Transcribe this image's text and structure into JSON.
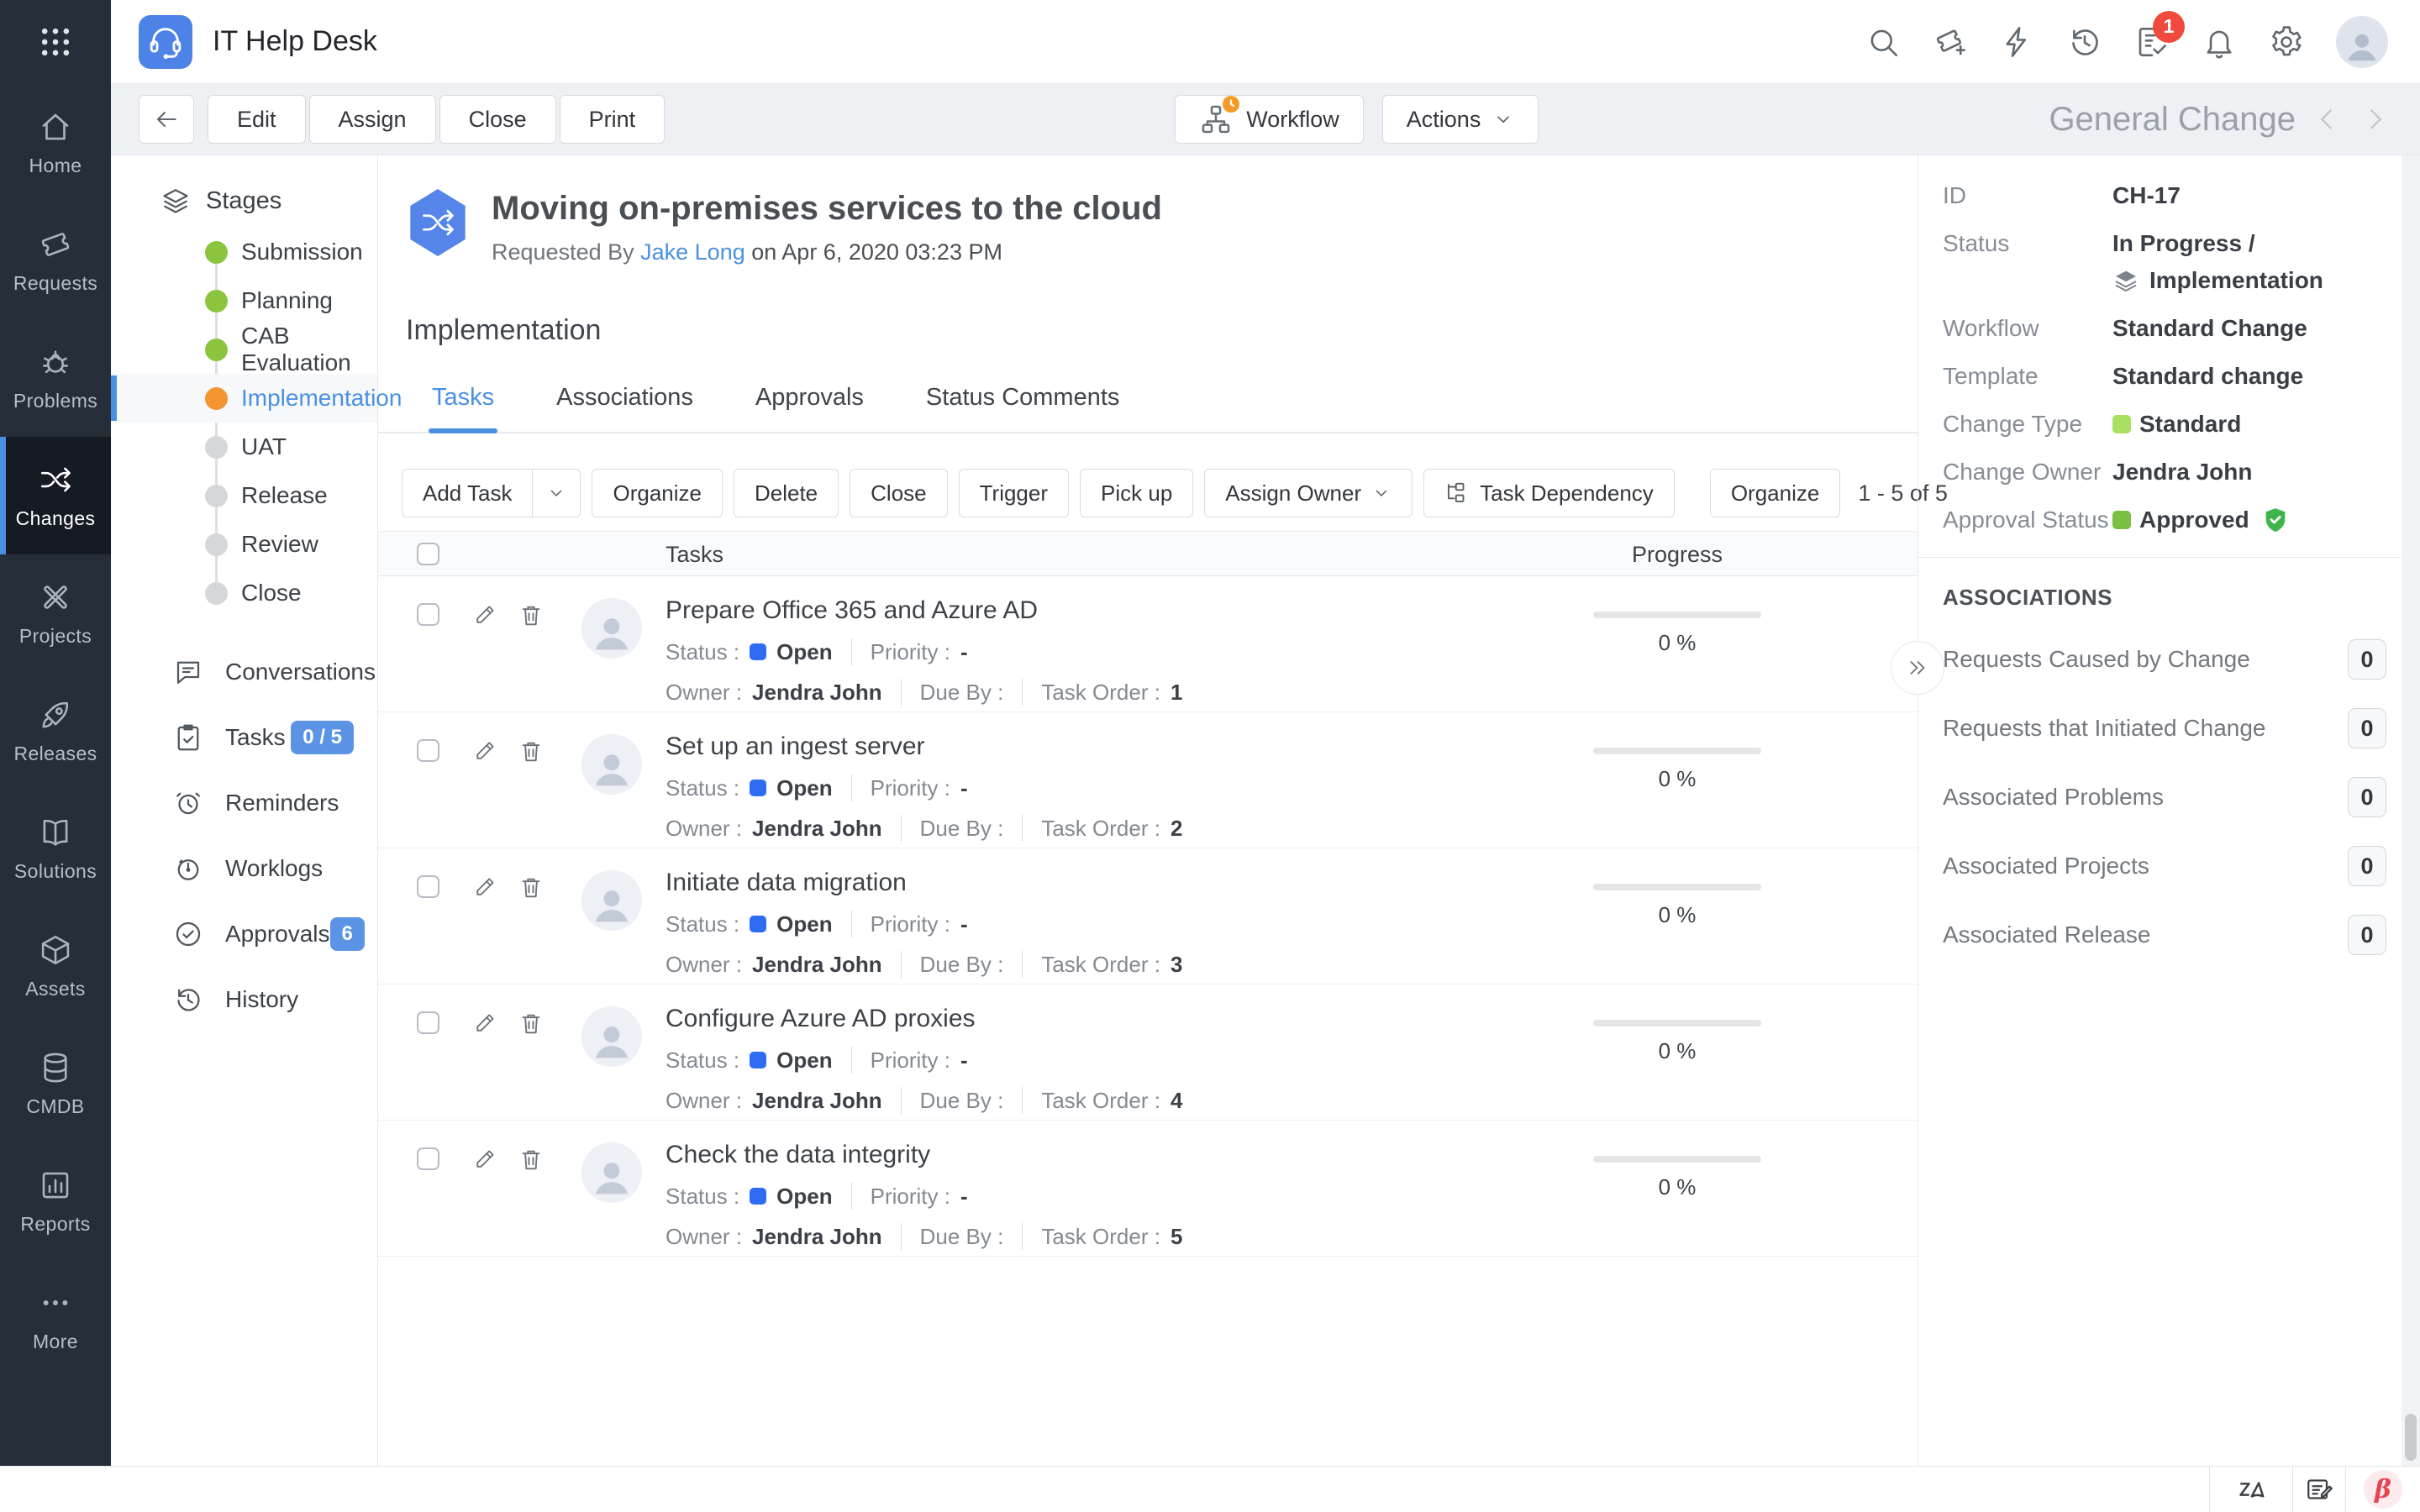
{
  "colors": {
    "accent": "#4a90e2",
    "stage_done": "#8bc53f",
    "stage_current": "#f5952f",
    "status_open": "#2e6cf6",
    "nav_badge": "#5b93e5",
    "approved_green": "#77c043",
    "change_type_green": "#a8e05f",
    "beta_red": "#e6444f"
  },
  "topbar": {
    "app_title": "IT Help Desk",
    "badge_count": "1"
  },
  "ribbon": {
    "buttons": [
      "Edit",
      "Assign",
      "Close",
      "Print"
    ],
    "workflow": "Workflow",
    "actions": "Actions",
    "record_type": "General Change"
  },
  "sidebar": {
    "items": [
      {
        "id": "home",
        "label": "Home",
        "icon": "home",
        "active": false
      },
      {
        "id": "requests",
        "label": "Requests",
        "icon": "ticket",
        "active": false
      },
      {
        "id": "problems",
        "label": "Problems",
        "icon": "bug",
        "active": false
      },
      {
        "id": "changes",
        "label": "Changes",
        "icon": "shuffle",
        "active": true
      },
      {
        "id": "projects",
        "label": "Projects",
        "icon": "tools",
        "active": false
      },
      {
        "id": "releases",
        "label": "Releases",
        "icon": "rocket",
        "active": false
      },
      {
        "id": "solutions",
        "label": "Solutions",
        "icon": "book",
        "active": false
      },
      {
        "id": "assets",
        "label": "Assets",
        "icon": "box",
        "active": false
      },
      {
        "id": "cmdb",
        "label": "CMDB",
        "icon": "database",
        "active": false
      },
      {
        "id": "reports",
        "label": "Reports",
        "icon": "report",
        "active": false
      },
      {
        "id": "more",
        "label": "More",
        "icon": "dots",
        "active": false
      }
    ]
  },
  "stage_panel": {
    "title": "Stages",
    "stages": [
      {
        "label": "Submission",
        "state": "done"
      },
      {
        "label": "Planning",
        "state": "done"
      },
      {
        "label": "CAB Evaluation",
        "state": "done"
      },
      {
        "label": "Implementation",
        "state": "current"
      },
      {
        "label": "UAT",
        "state": "pending"
      },
      {
        "label": "Release",
        "state": "pending"
      },
      {
        "label": "Review",
        "state": "pending"
      },
      {
        "label": "Close",
        "state": "pending"
      }
    ],
    "nav": [
      {
        "id": "conversations",
        "label": "Conversations",
        "icon": "chat",
        "badge": ""
      },
      {
        "id": "tasks",
        "label": "Tasks",
        "icon": "clipboard",
        "badge": "0 / 5"
      },
      {
        "id": "reminders",
        "label": "Reminders",
        "icon": "alarm",
        "badge": ""
      },
      {
        "id": "worklogs",
        "label": "Worklogs",
        "icon": "stopwatch",
        "badge": ""
      },
      {
        "id": "approvals",
        "label": "Approvals",
        "icon": "check-circle",
        "badge": "6"
      },
      {
        "id": "history",
        "label": "History",
        "icon": "history",
        "badge": ""
      }
    ]
  },
  "main": {
    "title": "Moving on-premises services to the cloud",
    "requested_by_label": "Requested By",
    "requester": "Jake Long",
    "requested_on": "on Apr 6, 2020 03:23 PM",
    "section_title": "Implementation",
    "tabs": [
      {
        "label": "Tasks",
        "active": true
      },
      {
        "label": "Associations",
        "active": false
      },
      {
        "label": "Approvals",
        "active": false
      },
      {
        "label": "Status Comments",
        "active": false
      }
    ],
    "task_toolbar": {
      "add_task": "Add Task",
      "organize": "Organize",
      "delete": "Delete",
      "close": "Close",
      "trigger": "Trigger",
      "pick_up": "Pick up",
      "assign_owner": "Assign Owner",
      "task_dependency": "Task Dependency",
      "organize2": "Organize",
      "pagination": "1 - 5 of 5"
    },
    "table": {
      "col_tasks": "Tasks",
      "col_progress": "Progress",
      "row_labels": {
        "status": "Status :",
        "priority": "Priority :",
        "owner": "Owner :",
        "due_by": "Due By :",
        "task_order": "Task Order :"
      },
      "rows": [
        {
          "title": "Prepare Office 365 and Azure AD",
          "status": "Open",
          "priority": "-",
          "owner": "Jendra John",
          "due_by": "",
          "task_order": "1",
          "progress": "0 %",
          "progress_pct": 0
        },
        {
          "title": "Set up an ingest server",
          "status": "Open",
          "priority": "-",
          "owner": "Jendra John",
          "due_by": "",
          "task_order": "2",
          "progress": "0 %",
          "progress_pct": 0
        },
        {
          "title": "Initiate data migration",
          "status": "Open",
          "priority": "-",
          "owner": "Jendra John",
          "due_by": "",
          "task_order": "3",
          "progress": "0 %",
          "progress_pct": 0
        },
        {
          "title": "Configure Azure AD proxies",
          "status": "Open",
          "priority": "-",
          "owner": "Jendra John",
          "due_by": "",
          "task_order": "4",
          "progress": "0 %",
          "progress_pct": 0
        },
        {
          "title": "Check the data integrity",
          "status": "Open",
          "priority": "-",
          "owner": "Jendra John",
          "due_by": "",
          "task_order": "5",
          "progress": "0 %",
          "progress_pct": 0
        }
      ]
    }
  },
  "details": {
    "fields": [
      {
        "label": "ID",
        "value": "CH-17"
      },
      {
        "label": "Status",
        "value": "In Progress /",
        "line2": "Implementation",
        "line2_icon": "layers"
      },
      {
        "label": "Workflow",
        "value": "Standard Change"
      },
      {
        "label": "Template",
        "value": "Standard change"
      },
      {
        "label": "Change Type",
        "value": "Standard",
        "swatch": "#a8e05f"
      },
      {
        "label": "Change Owner",
        "value": "Jendra John"
      },
      {
        "label": "Approval Status",
        "value": "Approved",
        "swatch": "#77c043",
        "shield": true
      }
    ],
    "associations_title": "ASSOCIATIONS",
    "associations": [
      {
        "label": "Requests Caused by Change",
        "count": "0"
      },
      {
        "label": "Requests that Initiated Change",
        "count": "0"
      },
      {
        "label": "Associated Problems",
        "count": "0"
      },
      {
        "label": "Associated Projects",
        "count": "0"
      },
      {
        "label": "Associated Release",
        "count": "0"
      }
    ]
  },
  "footer": {
    "beta": "β"
  }
}
